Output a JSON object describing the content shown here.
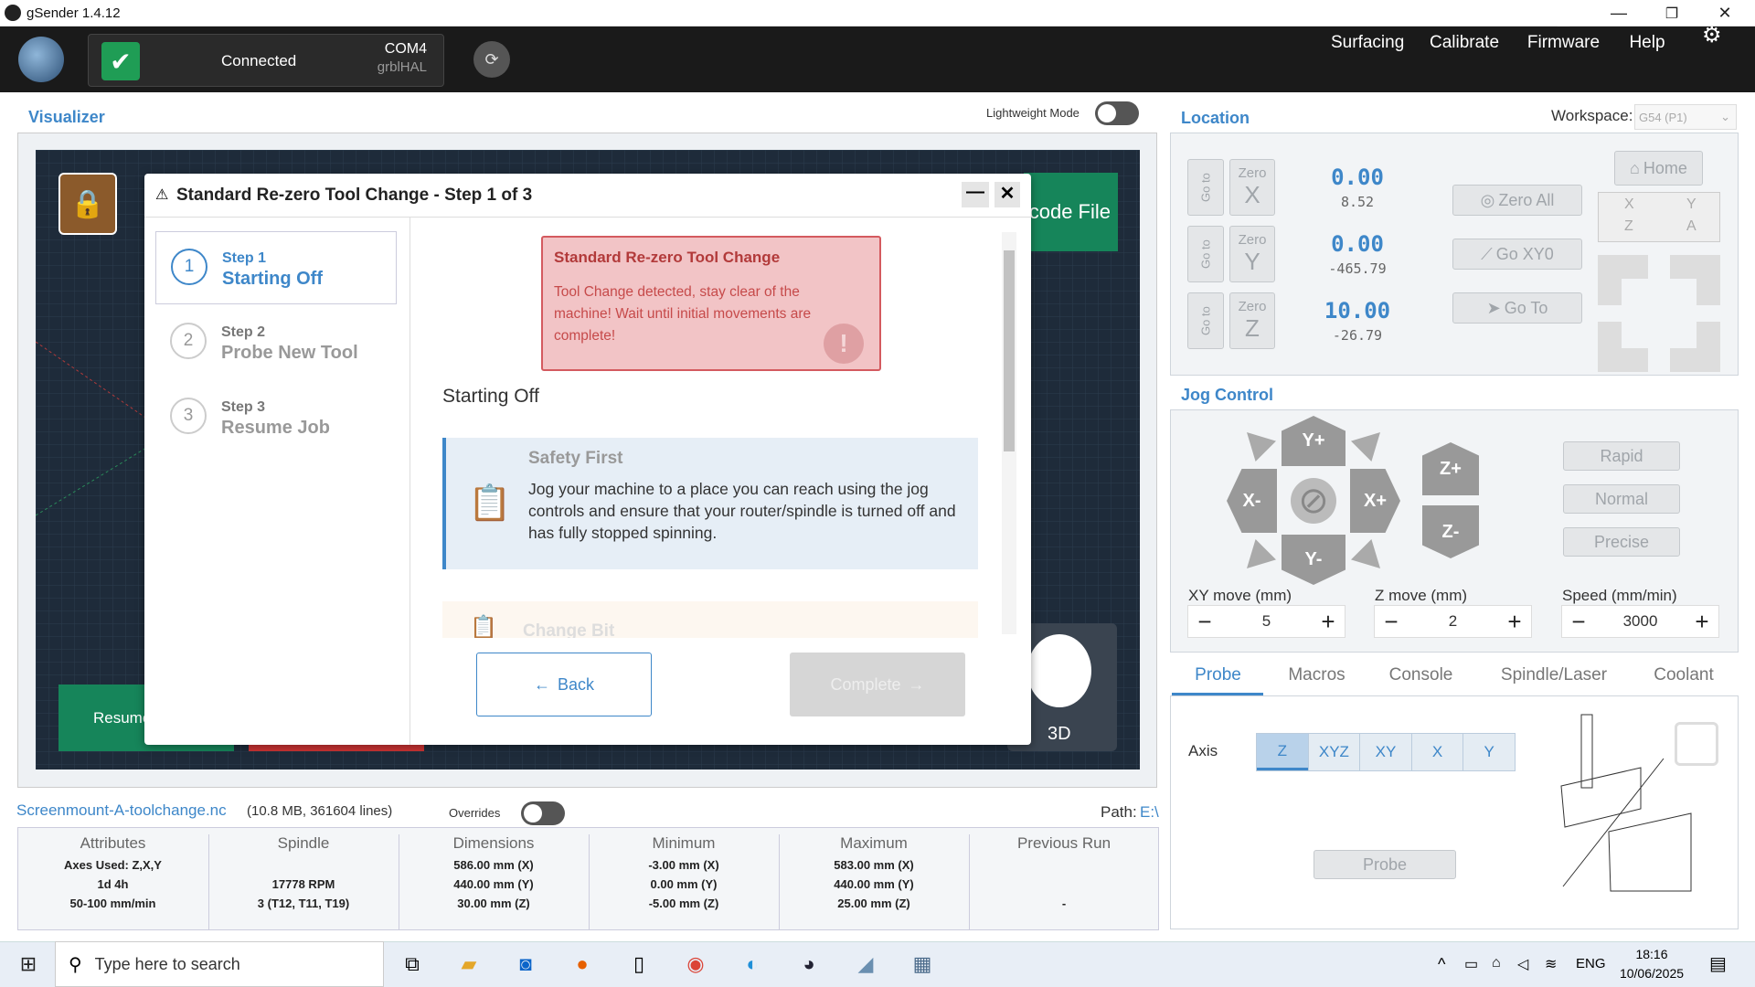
{
  "window": {
    "title": "gSender 1.4.12",
    "minimize": "—",
    "restore": "❐",
    "close": "✕"
  },
  "connection": {
    "status": "Connected",
    "port": "COM4",
    "firmware": "grblHAL"
  },
  "nav": {
    "surfacing": "Surfacing",
    "calibrate": "Calibrate",
    "firmware": "Firmware",
    "help": "Help"
  },
  "visualizer": {
    "title": "Visualizer",
    "lightweight_label": "Lightweight Mode",
    "load_file_fragment": "code File",
    "resume_fragment": "Resume",
    "view3d": "3D"
  },
  "modal": {
    "title": "Standard Re-zero Tool Change - Step 1 of 3",
    "steps": [
      {
        "num": "1",
        "label": "Step 1",
        "name": "Starting Off"
      },
      {
        "num": "2",
        "label": "Step 2",
        "name": "Probe New Tool"
      },
      {
        "num": "3",
        "label": "Step 3",
        "name": "Resume Job"
      }
    ],
    "alert": {
      "title": "Standard Re-zero Tool Change",
      "body": "Tool Change detected, stay clear of the machine! Wait until initial movements are complete!"
    },
    "section_title": "Starting Off",
    "safety": {
      "title": "Safety First",
      "body": "Jog your machine to a place you can reach using the jog controls and ensure that your router/spindle is turned off and has fully stopped spinning."
    },
    "next_card_title": "Change Bit",
    "back": "Back",
    "complete": "Complete"
  },
  "location": {
    "title": "Location",
    "workspace_label": "Workspace:",
    "workspace_value": "G54 (P1)",
    "goto": "Go to",
    "zero": "Zero",
    "axes": [
      {
        "axis": "X",
        "value": "0.00",
        "machine": "8.52"
      },
      {
        "axis": "Y",
        "value": "0.00",
        "machine": "-465.79"
      },
      {
        "axis": "Z",
        "value": "10.00",
        "machine": "-26.79"
      }
    ],
    "zero_all": "Zero All",
    "go_xy0": "Go XY0",
    "go_to": "Go To",
    "home": "Home",
    "mini": {
      "x": "X",
      "y": "Y",
      "z": "Z",
      "a": "A"
    }
  },
  "jog": {
    "title": "Jog Control",
    "labels": {
      "yplus": "Y+",
      "yminus": "Y-",
      "xplus": "X+",
      "xminus": "X-",
      "zplus": "Z+",
      "zminus": "Z-"
    },
    "speeds": [
      "Rapid",
      "Normal",
      "Precise"
    ],
    "xy_label": "XY move (mm)",
    "xy_value": "5",
    "z_label": "Z move (mm)",
    "z_value": "2",
    "speed_label": "Speed (mm/min)",
    "speed_value": "3000"
  },
  "tabs": [
    "Probe",
    "Macros",
    "Console",
    "Spindle/Laser",
    "Coolant"
  ],
  "probe": {
    "axis_label": "Axis",
    "axes": [
      "Z",
      "XYZ",
      "XY",
      "X",
      "Y"
    ],
    "button": "Probe"
  },
  "file": {
    "name": "Screenmount-A-toolchange.nc",
    "meta": "(10.8 MB, 361604 lines)",
    "overrides": "Overrides",
    "path_label": "Path:",
    "path_value": "E:\\"
  },
  "stats": [
    {
      "head": "Attributes",
      "lines": [
        "Axes Used: Z,X,Y",
        "1d 4h",
        "50-100 mm/min"
      ]
    },
    {
      "head": "Spindle",
      "lines": [
        "",
        "17778 RPM",
        "3 (T12, T11, T19)"
      ]
    },
    {
      "head": "Dimensions",
      "lines": [
        "586.00 mm (X)",
        "440.00 mm (Y)",
        "30.00 mm (Z)"
      ]
    },
    {
      "head": "Minimum",
      "lines": [
        "-3.00 mm (X)",
        "0.00 mm (Y)",
        "-5.00 mm (Z)"
      ]
    },
    {
      "head": "Maximum",
      "lines": [
        "583.00 mm (X)",
        "440.00 mm (Y)",
        "25.00 mm (Z)"
      ]
    },
    {
      "head": "Previous Run",
      "lines": [
        "",
        "",
        "-"
      ]
    }
  ],
  "taskbar": {
    "search_placeholder": "Type here to search",
    "lang": "ENG",
    "time": "18:16",
    "date": "10/06/2025"
  }
}
